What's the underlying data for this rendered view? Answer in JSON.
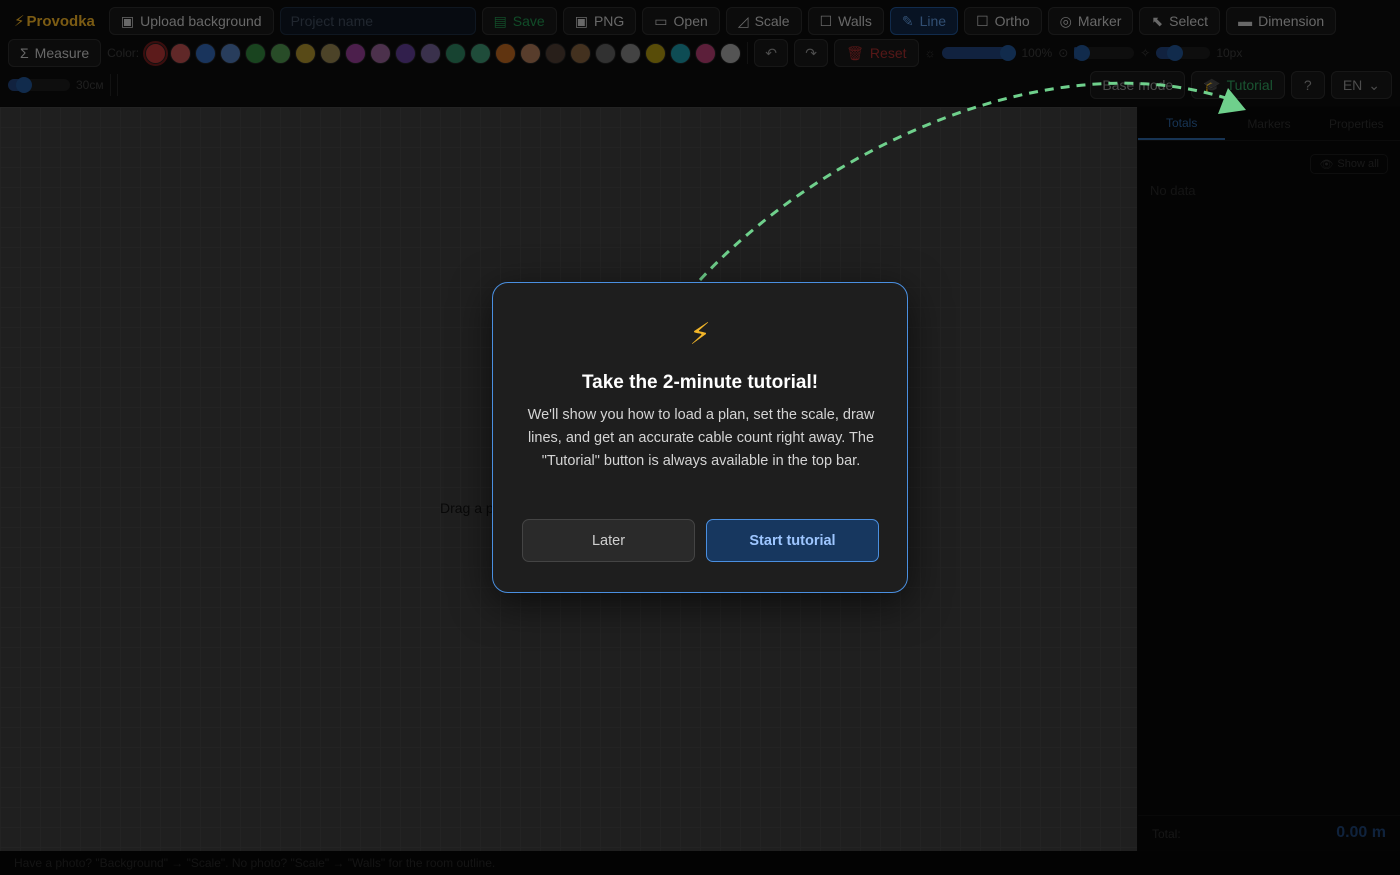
{
  "app": {
    "name": "Provodka"
  },
  "toolbar": {
    "upload_bg": "Upload background",
    "project_placeholder": "Project name",
    "save": "Save",
    "png": "PNG",
    "open": "Open",
    "scale": "Scale",
    "walls": "Walls",
    "line": "Line",
    "ortho": "Ortho",
    "marker": "Marker",
    "select": "Select",
    "dimension": "Dimension",
    "measure": "Measure",
    "color_label": "Color:",
    "reset": "Reset",
    "opacity_value": "100%",
    "opacity_fraction": 0.95,
    "zoom_fraction": 0.05,
    "line_width_value": "10px",
    "line_width_fraction": 0.35,
    "snap_value": "30см",
    "snap_fraction": 0.25,
    "base_mode": "Base mode",
    "tutorial": "Tutorial",
    "lang": "EN"
  },
  "colors": [
    "#a83232",
    "#b04a4a",
    "#2f5fa8",
    "#4a6fa8",
    "#2e7d3a",
    "#4a8a4a",
    "#a0882a",
    "#8a7a4a",
    "#8a3a8a",
    "#8a5a8a",
    "#5a3a8a",
    "#6a5a8a",
    "#2a7a5a",
    "#3a8a6a",
    "#b0601e",
    "#a07050",
    "#4a3a30",
    "#7a5a3a",
    "#5a5a5a",
    "#7a7a7a",
    "#a08a10",
    "#1a8a9a",
    "#a83a6a",
    "#9a9a9a"
  ],
  "panel": {
    "tabs": [
      "Totals",
      "Markers",
      "Properties"
    ],
    "show_all": "Show all",
    "no_data": "No data",
    "total_label": "Total:",
    "total_value": "0.00 m"
  },
  "canvas": {
    "drop_hint": "Drag a p"
  },
  "status": "Have a photo? \"Background\" → \"Scale\". No photo? \"Scale\" → \"Walls\" for the room outline.",
  "modal": {
    "icon": "⚡",
    "title": "Take the 2-minute tutorial!",
    "body": "We'll show you how to load a plan, set the scale, draw lines, and get an accurate cable count right away. The \"Tutorial\" button is always available in the top bar.",
    "later": "Later",
    "start": "Start tutorial"
  },
  "accent": {
    "arrow": "#6fd08c",
    "modal_border": "#4a8fe0",
    "logo": "#e0a624"
  }
}
